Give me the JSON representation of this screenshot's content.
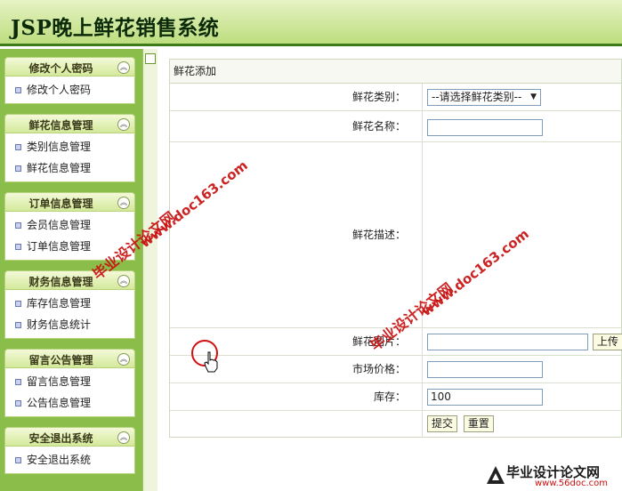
{
  "app": {
    "title": "JSP晚上鲜花销售系统"
  },
  "sidebar": {
    "groups": [
      {
        "title": "修改个人密码",
        "items": [
          "修改个人密码"
        ]
      },
      {
        "title": "鲜花信息管理",
        "items": [
          "类别信息管理",
          "鲜花信息管理"
        ]
      },
      {
        "title": "订单信息管理",
        "items": [
          "会员信息管理",
          "订单信息管理"
        ]
      },
      {
        "title": "财务信息管理",
        "items": [
          "库存信息管理",
          "财务信息统计"
        ]
      },
      {
        "title": "留言公告管理",
        "items": [
          "留言信息管理",
          "公告信息管理"
        ]
      },
      {
        "title": "安全退出系统",
        "items": [
          "安全退出系统"
        ]
      }
    ]
  },
  "form": {
    "title": "鲜花添加",
    "category_label": "鲜花类别：",
    "category_value": "--请选择鲜花类别--",
    "name_label": "鲜花名称：",
    "desc_label": "鲜花描述：",
    "image_label": "鲜花图片：",
    "upload_button": "上传",
    "price_label": "市场价格：",
    "stock_label": "库存：",
    "stock_value": "100",
    "submit_button": "提交",
    "reset_button": "重置"
  },
  "watermark": {
    "site": "www.doc163.com",
    "name": "毕业设计论文网",
    "footer_site": "www.56doc.com"
  }
}
